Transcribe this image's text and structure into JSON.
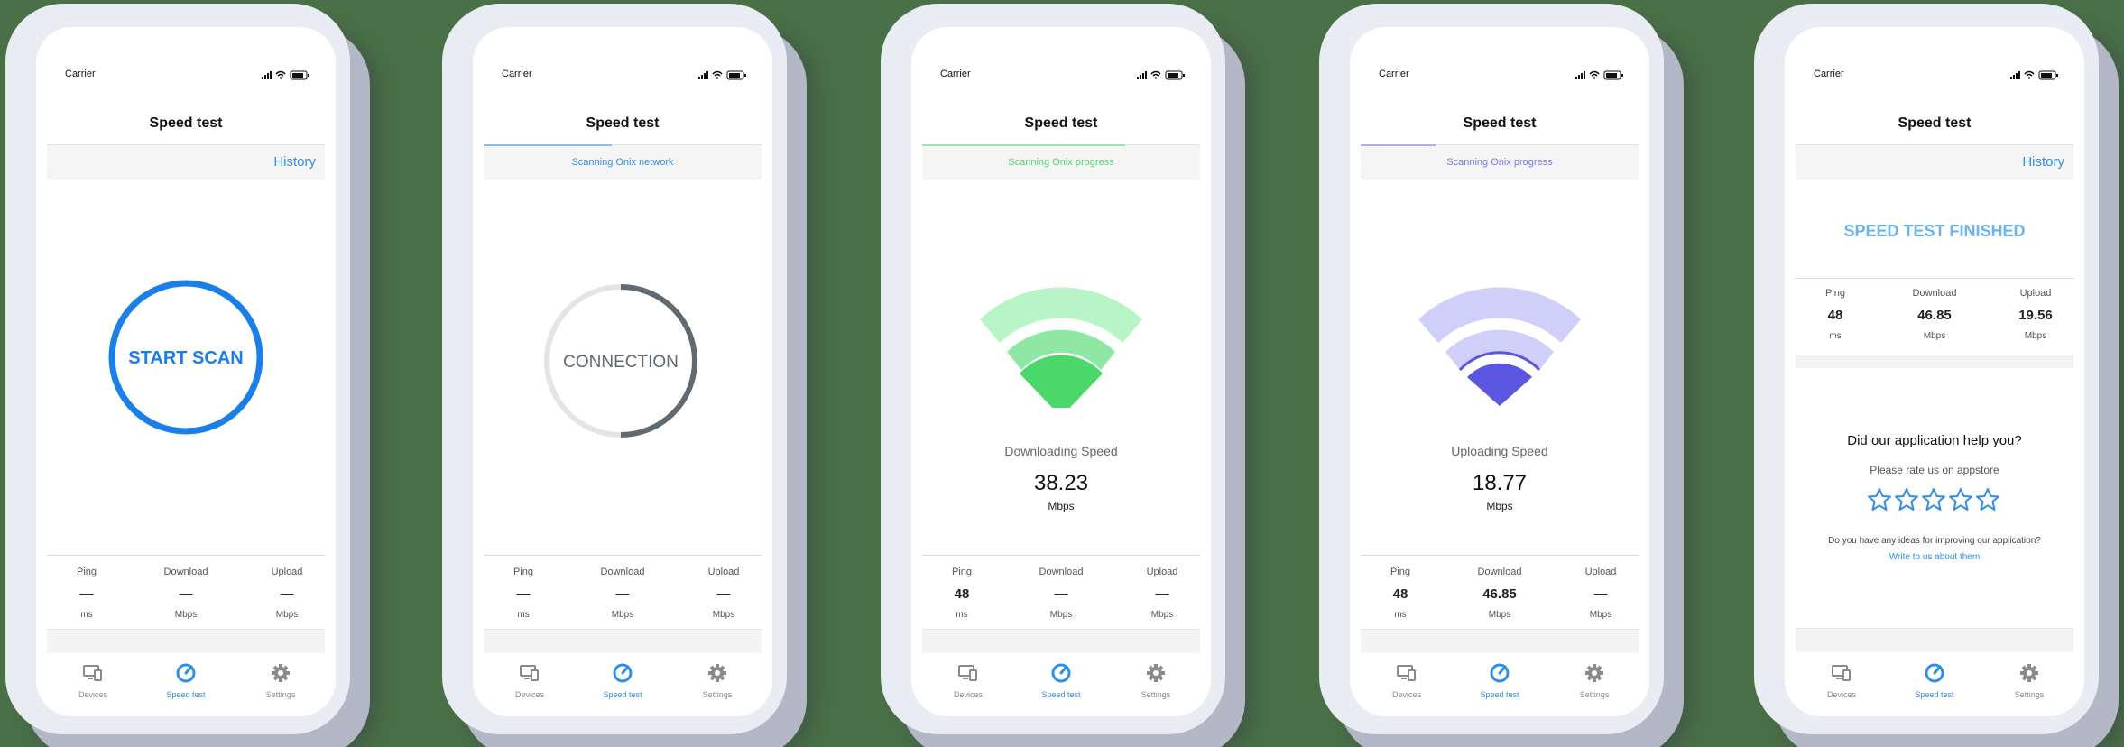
{
  "status": {
    "carrier": "Carrier"
  },
  "app": {
    "title": "Speed test"
  },
  "nav": {
    "history": "History"
  },
  "stat_labels": {
    "ping": "Ping",
    "download": "Download",
    "upload": "Upload"
  },
  "units": {
    "ms": "ms",
    "mbps": "Mbps"
  },
  "tabs": {
    "devices": "Devices",
    "speedtest": "Speed test",
    "settings": "Settings"
  },
  "screens": [
    {
      "scan_button": "START SCAN",
      "ping": "—",
      "download": "—",
      "upload": "—"
    },
    {
      "scanning": "Scanning Onix network",
      "progress": 0.46,
      "connection": "CONNECTION",
      "ping": "—",
      "download": "—",
      "upload": "—"
    },
    {
      "scanning": "Scanning Onix progress",
      "progress": 0.73,
      "speed_label": "Downloading Speed",
      "speed_value": "38.23",
      "speed_unit": "Mbps",
      "ping": "48",
      "download": "—",
      "upload": "—"
    },
    {
      "scanning": "Scanning Onix progress",
      "progress": 0.27,
      "speed_label": "Uploading Speed",
      "speed_value": "18.77",
      "speed_unit": "Mbps",
      "ping": "48",
      "download": "46.85",
      "upload": "—"
    },
    {
      "finished": "SPEED TEST FINISHED",
      "ping": "48",
      "download": "46.85",
      "upload": "19.56",
      "help_question": "Did our application help you?",
      "rate_prompt": "Please rate us on appstore",
      "rating": 0,
      "ideas_question": "Do you have any ideas for improving our application?",
      "write_link": "Write to us about them"
    }
  ],
  "colors": {
    "accent": "#1a7fe8",
    "scan_ring": "#1a7fe8",
    "connection_ring": "#5f6a73",
    "download_light": "#b8f5c6",
    "download_mid": "#8ee8a4",
    "download_dark": "#4bd86a",
    "upload_light": "#cfcffa",
    "upload_dark": "#5b56e0",
    "progress_green": "#9fe3b0",
    "progress_blue": "#92b8ee",
    "progress_purple": "#b0aef0"
  }
}
